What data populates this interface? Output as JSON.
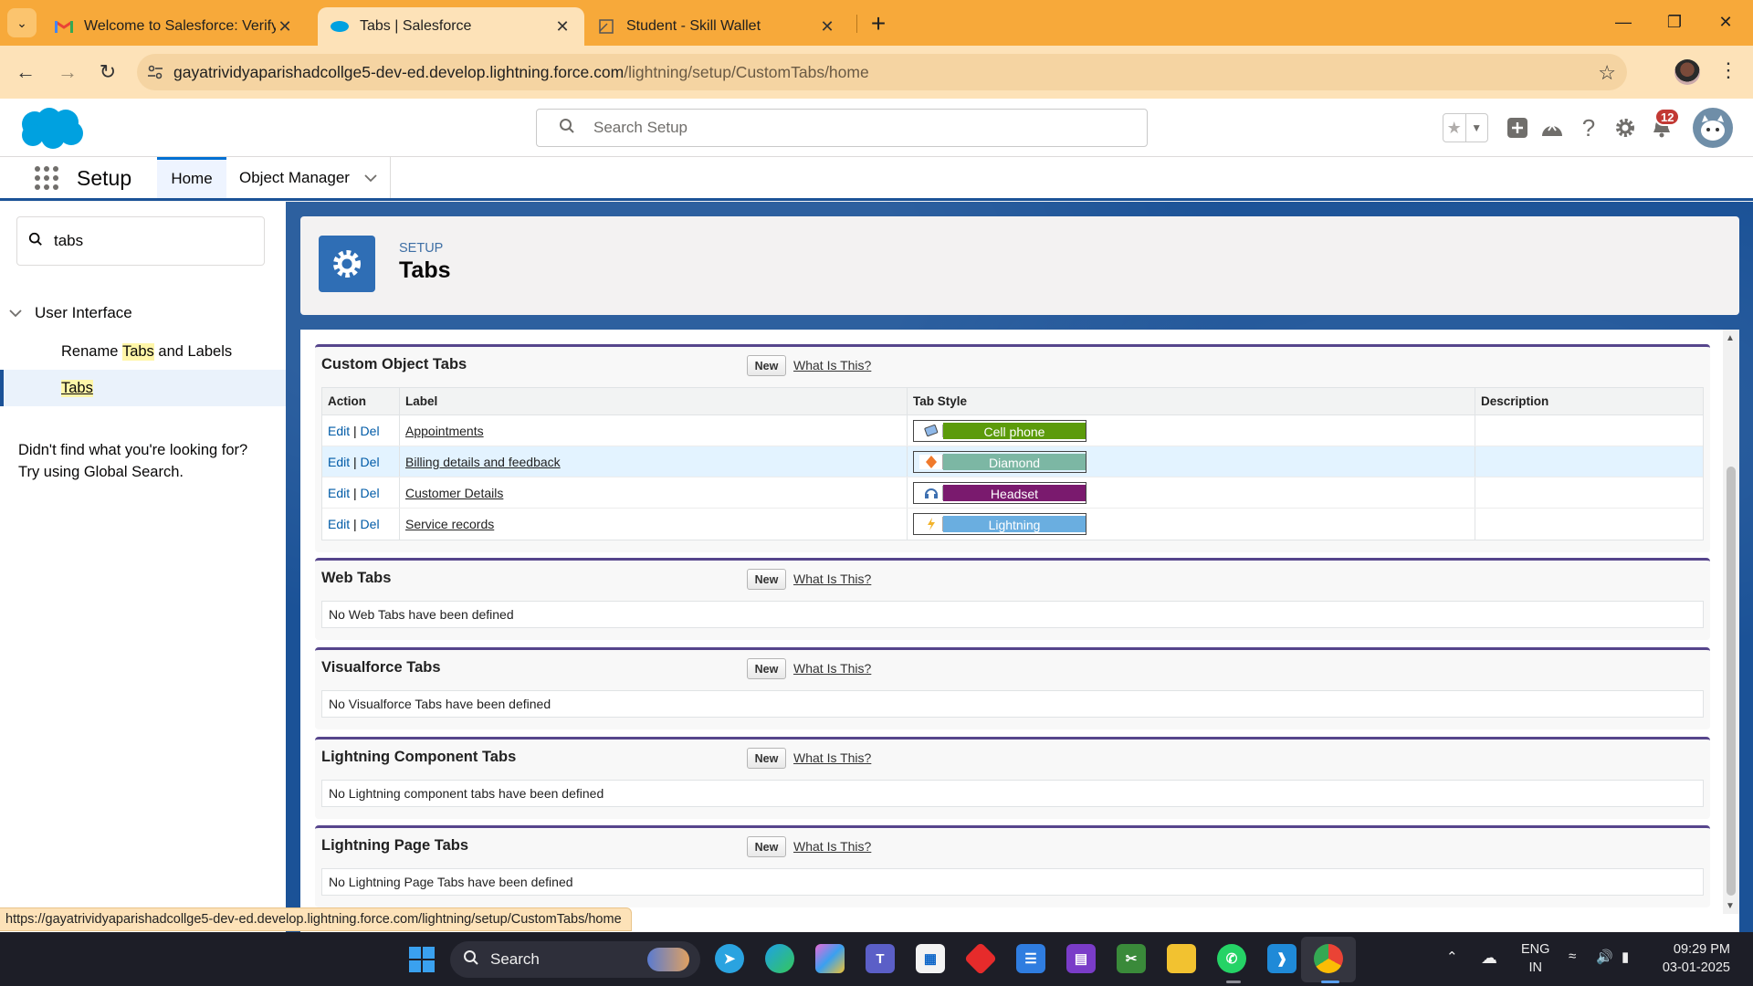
{
  "browser": {
    "tabs": [
      {
        "title": "Welcome to Salesforce: Verify y",
        "active": false
      },
      {
        "title": "Tabs | Salesforce",
        "active": true
      },
      {
        "title": "Student - Skill Wallet",
        "active": false
      }
    ],
    "url_host": "gayatrividyaparishadcollge5-dev-ed.develop.lightning.force.com",
    "url_path": "/lightning/setup/CustomTabs/home",
    "status_url": "https://gayatrividyaparishadcollge5-dev-ed.develop.lightning.force.com/lightning/setup/CustomTabs/home"
  },
  "header": {
    "search_placeholder": "Search Setup",
    "notification_count": "12"
  },
  "nav": {
    "app_name": "Setup",
    "home_label": "Home",
    "object_manager_label": "Object Manager"
  },
  "sidebar": {
    "quickfind_value": "tabs",
    "group_label": "User Interface",
    "items": [
      {
        "pre": "Rename ",
        "match": "Tabs",
        "post": " and Labels",
        "selected": false
      },
      {
        "pre": "",
        "match": "Tabs",
        "post": "",
        "selected": true
      }
    ],
    "not_found_line1": "Didn't find what you're looking for?",
    "not_found_line2": "Try using Global Search."
  },
  "page": {
    "kicker": "SETUP",
    "title": "Tabs"
  },
  "common": {
    "new_label": "New",
    "what_is_this": "What Is This?",
    "edit": "Edit",
    "separator": "|",
    "del": "Del"
  },
  "custom_object_tabs": {
    "title": "Custom Object Tabs",
    "columns": [
      "Action",
      "Label",
      "Tab Style",
      "Description"
    ],
    "rows": [
      {
        "label": "Appointments",
        "style": "Cell phone",
        "color": "#5c9b0b",
        "icon": "cell-phone-icon",
        "description": ""
      },
      {
        "label": "Billing details and feedback",
        "style": "Diamond",
        "color": "#7cb7a4",
        "icon": "diamond-icon",
        "description": ""
      },
      {
        "label": "Customer Details",
        "style": "Headset",
        "color": "#7a1a6e",
        "icon": "headset-icon",
        "description": ""
      },
      {
        "label": "Service records",
        "style": "Lightning",
        "color": "#6aaee0",
        "icon": "lightning-icon",
        "description": ""
      }
    ]
  },
  "web_tabs": {
    "title": "Web Tabs",
    "empty": "No Web Tabs have been defined"
  },
  "visualforce_tabs": {
    "title": "Visualforce Tabs",
    "empty": "No Visualforce Tabs have been defined"
  },
  "lightning_component_tabs": {
    "title": "Lightning Component Tabs",
    "empty": "No Lightning component tabs have been defined"
  },
  "lightning_page_tabs": {
    "title": "Lightning Page Tabs",
    "empty": "No Lightning Page Tabs have been defined"
  },
  "taskbar": {
    "search_label": "Search",
    "lang_line1": "ENG",
    "lang_line2": "IN",
    "time": "09:29 PM",
    "date": "03-01-2025"
  }
}
